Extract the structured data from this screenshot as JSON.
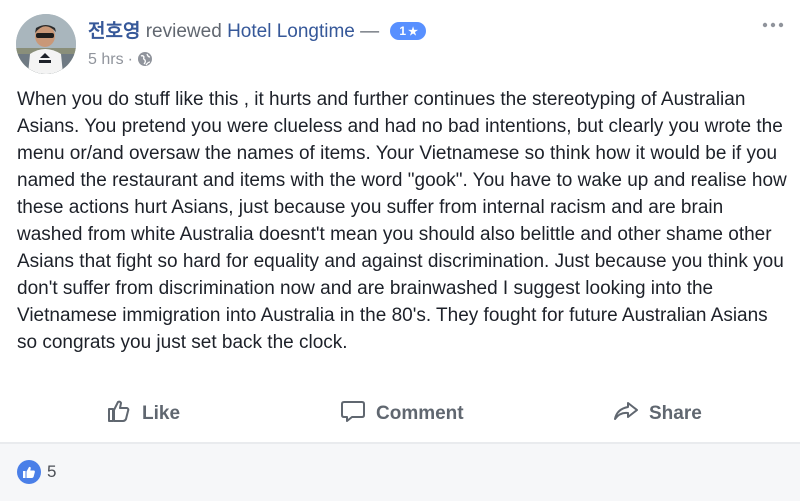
{
  "header": {
    "author": "전호영",
    "verb": "reviewed",
    "page": "Hotel Longtime",
    "dash": "—",
    "rating": "1",
    "rating_star": "★",
    "time": "5 hrs",
    "dot": "·"
  },
  "body": {
    "text": "When you do stuff like this , it hurts and further continues the stereotyping of Australian Asians. You pretend you were clueless and had no bad intentions, but clearly you wrote the menu or/and oversaw the names of items. Your Vietnamese so think how it would be if you named the restaurant and items with the word \"gook\". You have to wake up and realise how these actions hurt Asians, just because you suffer from internal racism and are brain washed from white Australia doesnt't mean you should also belittle and other shame other Asians that fight so hard for equality and against discrimination. Just because you think you don't suffer from discrimination now and are brainwashed I suggest looking into the Vietnamese immigration into Australia in the 80's. They fought for future Australian Asians so congrats you just set back the clock."
  },
  "actions": {
    "like": "Like",
    "comment": "Comment",
    "share": "Share"
  },
  "reactions": {
    "count": "5"
  },
  "icons": {
    "options": "more-options-icon",
    "globe": "globe-icon",
    "like": "thumbs-up-icon",
    "comment": "speech-bubble-icon",
    "share": "share-arrow-icon"
  },
  "colors": {
    "link": "#365899",
    "badge": "#5890ff",
    "muted": "#90949c",
    "action": "#606770"
  }
}
